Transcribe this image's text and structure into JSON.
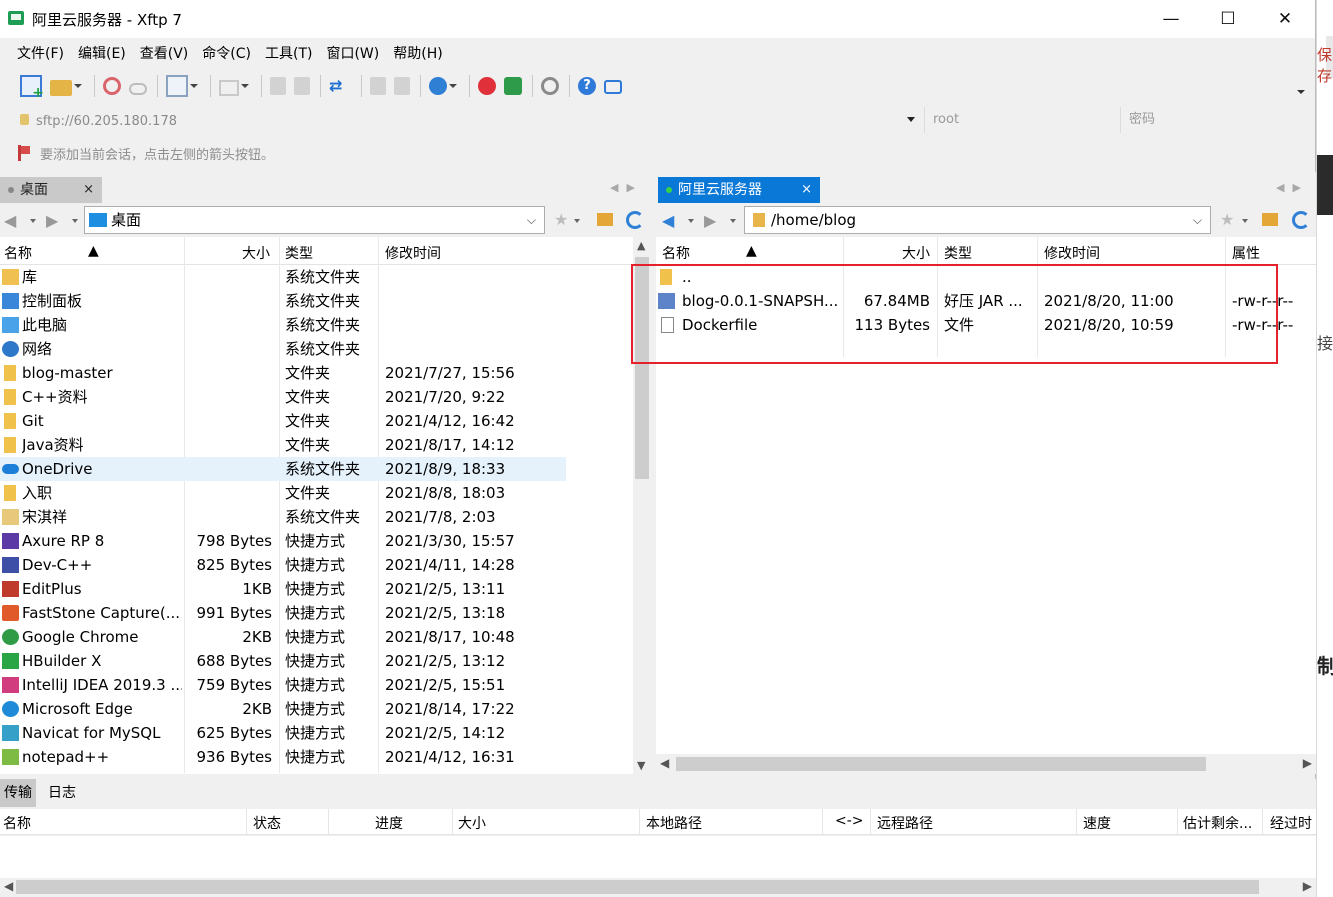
{
  "window": {
    "title": "阿里云服务器 - Xftp 7",
    "minimize": "—",
    "maximize": "☐",
    "close": "✕"
  },
  "menu": [
    "文件(F)",
    "编辑(E)",
    "查看(V)",
    "命令(C)",
    "工具(T)",
    "窗口(W)",
    "帮助(H)"
  ],
  "address": {
    "url_placeholder": "sftp://60.205.180.178",
    "user_placeholder": "root",
    "password_placeholder": "密码"
  },
  "hint": "要添加当前会话，点击左侧的箭头按钮。",
  "left": {
    "tab": "桌面",
    "tab_close": "×",
    "path": "桌面",
    "columns": [
      "名称",
      "大小",
      "类型",
      "修改时间"
    ],
    "rows": [
      {
        "name": "库",
        "size": "",
        "type": "系统文件夹",
        "mtime": "",
        "icon": "library-icon"
      },
      {
        "name": "控制面板",
        "size": "",
        "type": "系统文件夹",
        "mtime": "",
        "icon": "control-panel-icon"
      },
      {
        "name": "此电脑",
        "size": "",
        "type": "系统文件夹",
        "mtime": "",
        "icon": "computer-icon"
      },
      {
        "name": "网络",
        "size": "",
        "type": "系统文件夹",
        "mtime": "",
        "icon": "network-icon"
      },
      {
        "name": "blog-master",
        "size": "",
        "type": "文件夹",
        "mtime": "2021/7/27, 15:56",
        "icon": "folder-icon"
      },
      {
        "name": "C++资料",
        "size": "",
        "type": "文件夹",
        "mtime": "2021/7/20, 9:22",
        "icon": "folder-icon"
      },
      {
        "name": "Git",
        "size": "",
        "type": "文件夹",
        "mtime": "2021/4/12, 16:42",
        "icon": "folder-icon"
      },
      {
        "name": "Java资料",
        "size": "",
        "type": "文件夹",
        "mtime": "2021/8/17, 14:12",
        "icon": "folder-icon"
      },
      {
        "name": "OneDrive",
        "size": "",
        "type": "系统文件夹",
        "mtime": "2021/8/9, 18:33",
        "icon": "onedrive-icon",
        "selected": true
      },
      {
        "name": "入职",
        "size": "",
        "type": "文件夹",
        "mtime": "2021/8/8, 18:03",
        "icon": "folder-icon"
      },
      {
        "name": "宋淇祥",
        "size": "",
        "type": "系统文件夹",
        "mtime": "2021/7/8, 2:03",
        "icon": "user-folder-icon"
      },
      {
        "name": "Axure RP 8",
        "size": "798 Bytes",
        "type": "快捷方式",
        "mtime": "2021/3/30, 15:57",
        "icon": "axure-icon"
      },
      {
        "name": "Dev-C++",
        "size": "825 Bytes",
        "type": "快捷方式",
        "mtime": "2021/4/11, 14:28",
        "icon": "devcpp-icon"
      },
      {
        "name": "EditPlus",
        "size": "1KB",
        "type": "快捷方式",
        "mtime": "2021/2/5, 13:11",
        "icon": "editplus-icon"
      },
      {
        "name": "FastStone Capture(...",
        "size": "991 Bytes",
        "type": "快捷方式",
        "mtime": "2021/2/5, 13:18",
        "icon": "faststone-icon"
      },
      {
        "name": "Google Chrome",
        "size": "2KB",
        "type": "快捷方式",
        "mtime": "2021/8/17, 10:48",
        "icon": "chrome-icon"
      },
      {
        "name": "HBuilder X",
        "size": "688 Bytes",
        "type": "快捷方式",
        "mtime": "2021/2/5, 13:12",
        "icon": "hbuilder-icon"
      },
      {
        "name": "IntelliJ IDEA 2019.3 ...",
        "size": "759 Bytes",
        "type": "快捷方式",
        "mtime": "2021/2/5, 15:51",
        "icon": "intellij-icon"
      },
      {
        "name": "Microsoft Edge",
        "size": "2KB",
        "type": "快捷方式",
        "mtime": "2021/8/14, 17:22",
        "icon": "edge-icon"
      },
      {
        "name": "Navicat for MySQL",
        "size": "625 Bytes",
        "type": "快捷方式",
        "mtime": "2021/2/5, 14:12",
        "icon": "navicat-icon"
      },
      {
        "name": "notepad++",
        "size": "936 Bytes",
        "type": "快捷方式",
        "mtime": "2021/4/12, 16:31",
        "icon": "notepadpp-icon"
      }
    ]
  },
  "right": {
    "tab": "阿里云服务器",
    "tab_close": "×",
    "path": "/home/blog",
    "columns": [
      "名称",
      "大小",
      "类型",
      "修改时间",
      "属性"
    ],
    "rows": [
      {
        "name": "..",
        "size": "",
        "type": "",
        "mtime": "",
        "attr": "",
        "icon": "parent-folder-icon"
      },
      {
        "name": "blog-0.0.1-SNAPSH...",
        "size": "67.84MB",
        "type": "好压 JAR ...",
        "mtime": "2021/8/20, 11:00",
        "attr": "-rw-r--r--",
        "icon": "jar-archive-icon"
      },
      {
        "name": "Dockerfile",
        "size": "113 Bytes",
        "type": "文件",
        "mtime": "2021/8/20, 10:59",
        "attr": "-rw-r--r--",
        "icon": "file-icon"
      }
    ]
  },
  "transfer": {
    "tabs": [
      "传输",
      "日志"
    ],
    "columns": [
      "名称",
      "状态",
      "进度",
      "大小",
      "本地路径",
      "<->",
      "远程路径",
      "速度",
      "估计剩余...",
      "经过时"
    ]
  },
  "bleed": {
    "t1": "保存",
    "t2": "接",
    "t3": "制"
  },
  "colors": {
    "accent": "#0a78d7",
    "highlight_box": "#e5222b",
    "selection": "#e5f1fb"
  }
}
